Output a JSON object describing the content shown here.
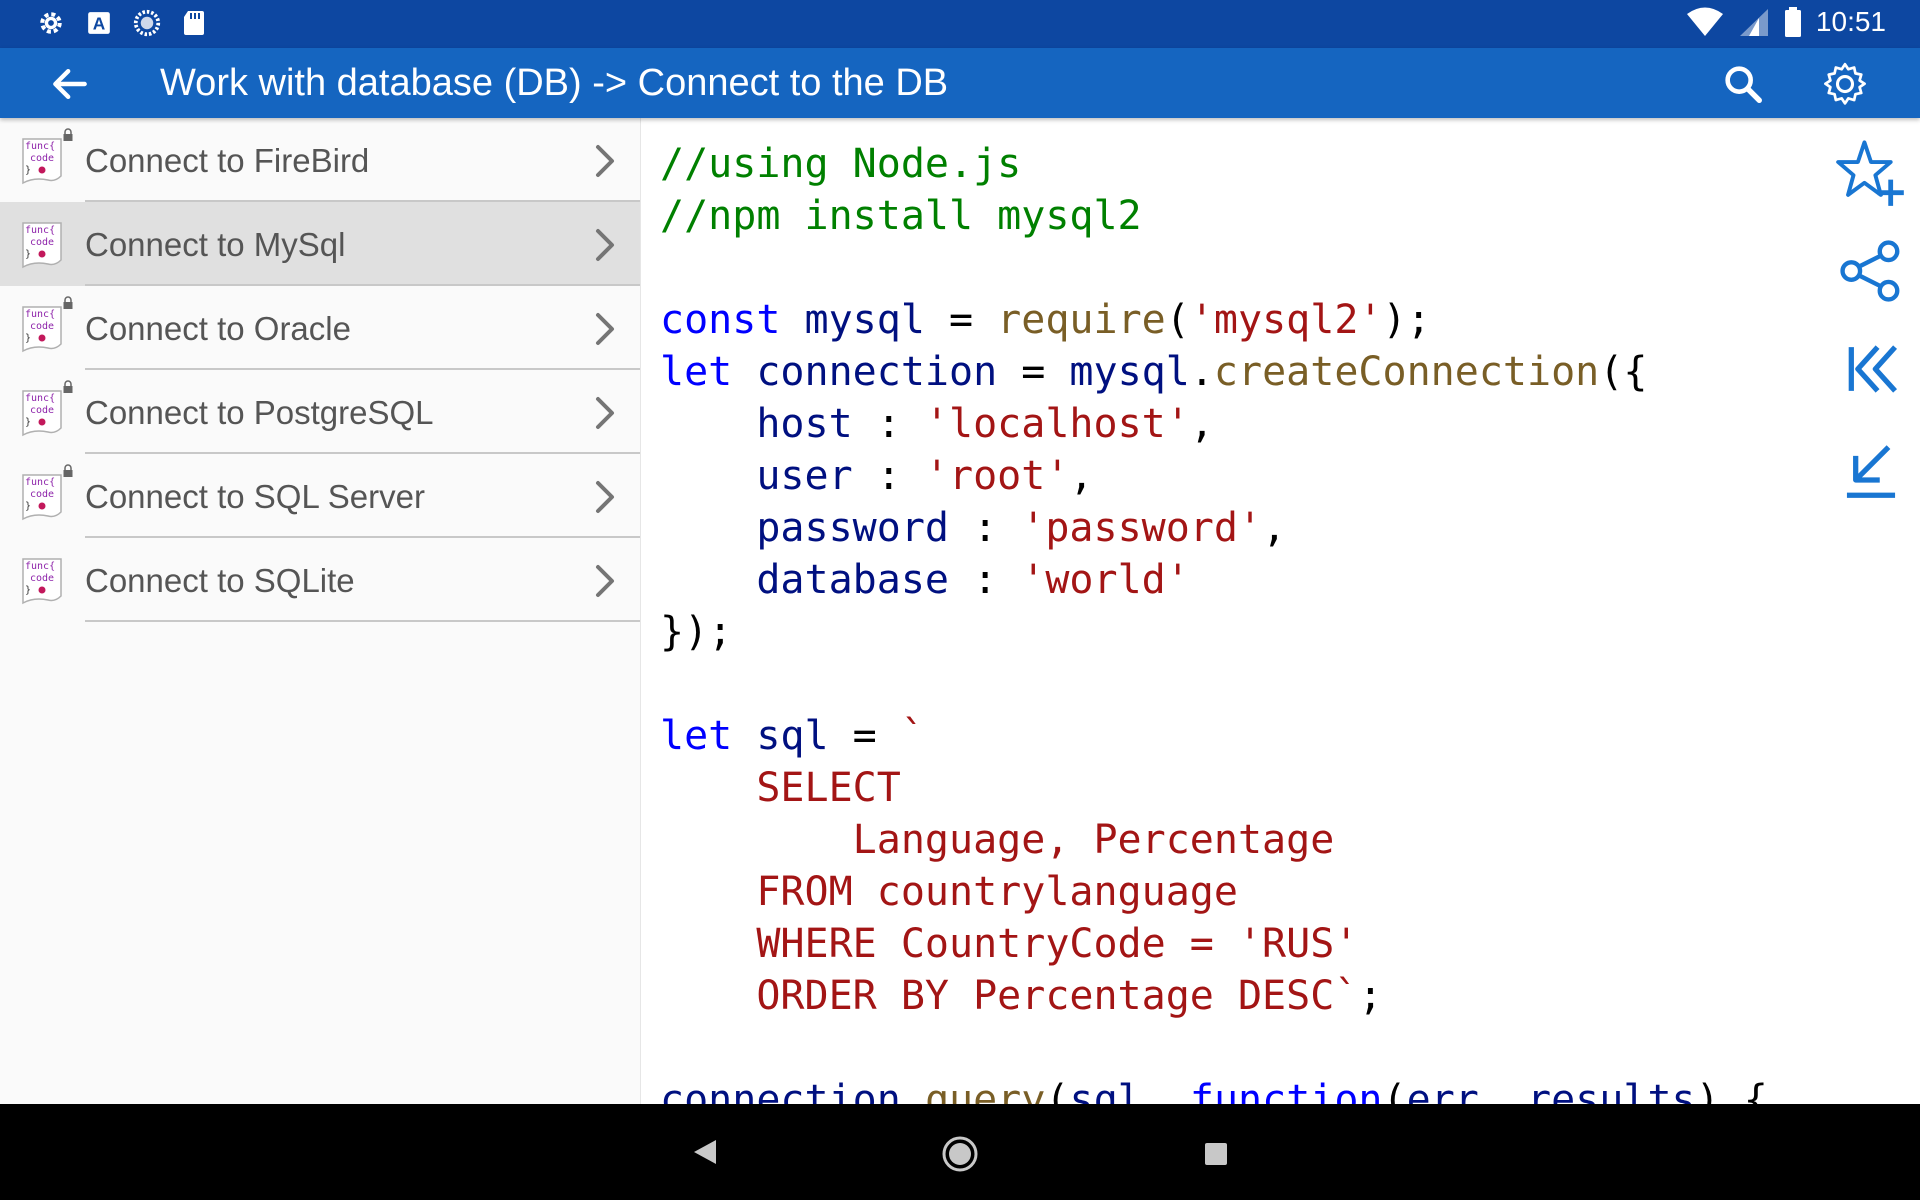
{
  "status_bar": {
    "time": "10:51",
    "left_icons": [
      "settings-icon",
      "text-a-icon",
      "loading-icon",
      "sd-card-icon"
    ],
    "right_icons": [
      "wifi-icon",
      "signal-icon",
      "battery-icon"
    ]
  },
  "app_bar": {
    "title": "Work with database (DB) -> Connect to the DB",
    "icons": [
      "back-arrow-icon",
      "search-icon",
      "gear-icon"
    ]
  },
  "sidebar": {
    "items": [
      {
        "label": "Connect to FireBird",
        "locked": true,
        "selected": false
      },
      {
        "label": "Connect to MySql",
        "locked": false,
        "selected": true
      },
      {
        "label": "Connect to Oracle",
        "locked": true,
        "selected": false
      },
      {
        "label": "Connect to PostgreSQL",
        "locked": true,
        "selected": false
      },
      {
        "label": "Connect to SQL Server",
        "locked": true,
        "selected": false
      },
      {
        "label": "Connect to SQLite",
        "locked": false,
        "selected": false
      }
    ],
    "file_icon_text": [
      "func{",
      "code",
      "}"
    ]
  },
  "code": {
    "comment1": "//using Node.js",
    "comment2": "//npm install mysql2",
    "l3_kw": "const",
    "l3_id": " mysql",
    "l3_op": " = ",
    "l3_fn": "require",
    "l3_p1": "(",
    "l3_str": "'mysql2'",
    "l3_p2": ");",
    "l4_kw": "let",
    "l4_id": " connection",
    "l4_op": " = ",
    "l4_id2": "mysql",
    "l4_dot": ".",
    "l4_fn": "createConnection",
    "l4_p": "({",
    "l5_key": "    host",
    "l5_sep": " : ",
    "l5_str": "'localhost'",
    "l5_c": ",",
    "l6_key": "    user",
    "l6_sep": " : ",
    "l6_str": "'root'",
    "l6_c": ",",
    "l7_key": "    password",
    "l7_sep": " : ",
    "l7_str": "'password'",
    "l7_c": ",",
    "l8_key": "    database",
    "l8_sep": " : ",
    "l8_str": "'world'",
    "l9": "});",
    "l10_kw": "let",
    "l10_id": " sql",
    "l10_op": " = ",
    "l10_str": "`",
    "l11": "    SELECT",
    "l12": "        Language, Percentage",
    "l13": "    FROM countrylanguage",
    "l14": "    WHERE CountryCode = 'RUS'",
    "l15_str": "    ORDER BY Percentage DESC`",
    "l15_p": ";",
    "l16_id": "connection",
    "l16_dot": ".",
    "l16_fn": "query",
    "l16_p1": "(",
    "l16_id2": "sql",
    "l16_c": ", ",
    "l16_kw": "function",
    "l16_p2": "(",
    "l16_id3": "err",
    "l16_c2": ", ",
    "l16_id4": "results",
    "l16_p3": ") {"
  },
  "actions": [
    "star-add-icon",
    "share-icon",
    "skip-to-start-icon",
    "arrow-down-left-icon"
  ],
  "nav_bar": [
    "back-triangle-icon",
    "home-circle-icon",
    "recents-square-icon"
  ],
  "colors": {
    "status_bar": "#0d47a1",
    "app_bar": "#1565c0",
    "accent": "#1976d2",
    "comment": "#008000",
    "keyword": "#0000ff",
    "identifier": "#001080",
    "function": "#795e26",
    "string": "#a31515"
  }
}
